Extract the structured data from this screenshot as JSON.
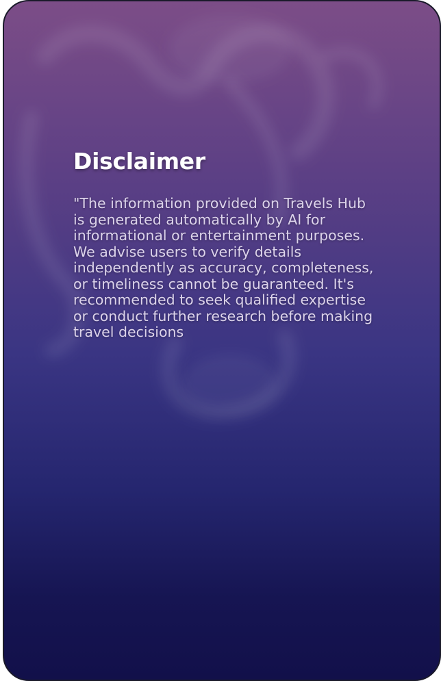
{
  "disclaimer": {
    "title": "Disclaimer",
    "text": "\"The information provided on Travels Hub is generated automatically by AI for informational or entertainment purposes. We advise users to verify details independently as accuracy, completeness, or timeliness cannot be guaranteed. It's recommended to seek qualified expertise or conduct further research before making travel decisions"
  },
  "colors": {
    "top_gradient": "#7c4d87",
    "mid_gradient": "#3a3583",
    "bottom_gradient": "#12104a",
    "title": "#ffffff",
    "body_text": "#dcd3ea"
  }
}
